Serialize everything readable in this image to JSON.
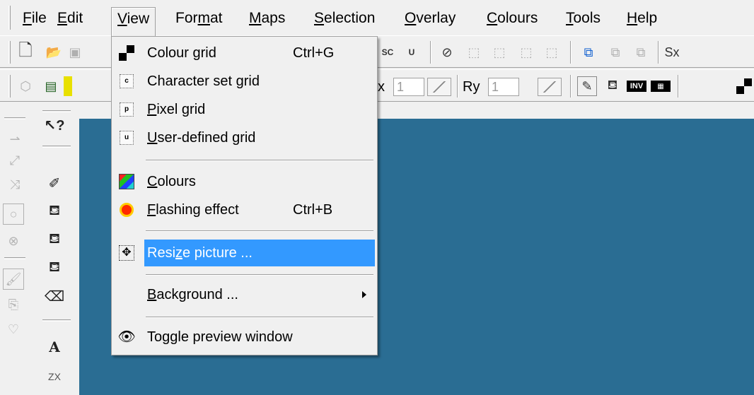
{
  "menubar": {
    "items": [
      "File",
      "Edit",
      "View",
      "Format",
      "Maps",
      "Selection",
      "Overlay",
      "Colours",
      "Tools",
      "Help"
    ],
    "active": "View"
  },
  "toolbar2": {
    "rx_label": "x",
    "rx_value": "1",
    "ry_label": "Ry",
    "ry_value": "1"
  },
  "toolbar1": {
    "right_label": "Sx"
  },
  "lefttools": {
    "text_tool": "A",
    "zx_tool": "ZX"
  },
  "view_menu": {
    "items": [
      {
        "label": "Colour grid",
        "shortcut": "Ctrl+G",
        "icon": "colour-grid-icon"
      },
      {
        "label": "Character set grid",
        "shortcut": "",
        "icon": "character-set-grid-icon",
        "icon_text": "c"
      },
      {
        "label": "Pixel grid",
        "shortcut": "",
        "icon": "pixel-grid-icon",
        "icon_text": "p"
      },
      {
        "label": "User-defined grid",
        "shortcut": "",
        "icon": "user-defined-grid-icon",
        "icon_text": "u"
      },
      {
        "label": "Colours",
        "shortcut": "",
        "icon": "colours-icon"
      },
      {
        "label": "Flashing effect",
        "shortcut": "Ctrl+B",
        "icon": "flashing-effect-icon"
      },
      {
        "label": "Resize picture ...",
        "shortcut": "",
        "icon": "resize-picture-icon",
        "highlighted": true
      },
      {
        "label": "Background ...",
        "shortcut": "",
        "icon": "",
        "submenu": true
      },
      {
        "label": "Toggle preview window",
        "shortcut": "",
        "icon": "eye-icon"
      }
    ]
  },
  "colors": {
    "canvas": "#2a6d93",
    "highlight": "#3399ff",
    "menu_bg": "#f0f0f0"
  }
}
